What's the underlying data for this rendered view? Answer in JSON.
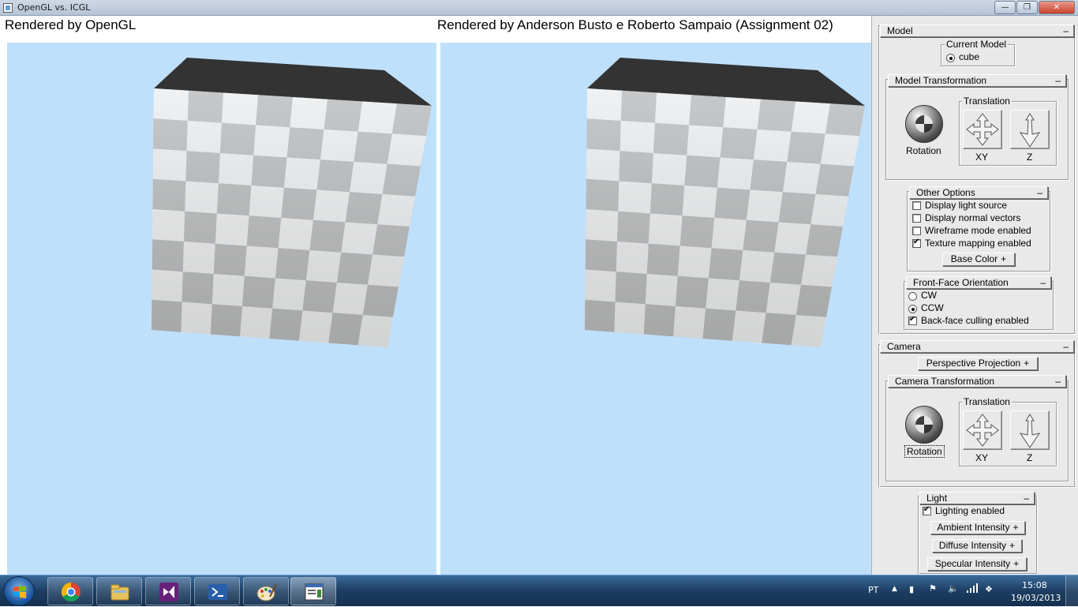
{
  "window": {
    "title": "OpenGL vs. ICGL"
  },
  "viewports": {
    "left_title": "Rendered by OpenGL",
    "right_title": "Rendered by Anderson Busto e Roberto Sampaio (Assignment 02)"
  },
  "panel": {
    "model": {
      "header": "Model",
      "current_model_label": "Current Model",
      "current_model_value": "cube",
      "transform": {
        "header": "Model Transformation",
        "rotation_label": "Rotation",
        "translation_label": "Translation",
        "xy_label": "XY",
        "z_label": "Z"
      },
      "other_options": {
        "header": "Other Options",
        "items": [
          {
            "label": "Display light source",
            "checked": false
          },
          {
            "label": "Display normal vectors",
            "checked": false
          },
          {
            "label": "Wireframe mode enabled",
            "checked": false
          },
          {
            "label": "Texture mapping enabled",
            "checked": true
          }
        ],
        "base_color": "Base Color"
      },
      "front_face": {
        "header": "Front-Face Orientation",
        "cw": "CW",
        "ccw": "CCW",
        "selected": "CCW",
        "culling_label": "Back-face culling enabled",
        "culling_checked": true
      }
    },
    "camera": {
      "header": "Camera",
      "projection_button": "Perspective Projection",
      "transform": {
        "header": "Camera Transformation",
        "rotation_label": "Rotation",
        "translation_label": "Translation",
        "xy_label": "XY",
        "z_label": "Z"
      }
    },
    "light": {
      "header": "Light",
      "lighting_label": "Lighting enabled",
      "lighting_checked": true,
      "ambient": "Ambient Intensity",
      "diffuse": "Diffuse Intensity",
      "specular": "Specular Intensity"
    },
    "collapse_symbol": "–",
    "expand_symbol": "+"
  },
  "taskbar": {
    "apps": [
      "chrome-icon",
      "explorer-icon",
      "visual-studio-icon",
      "powershell-icon",
      "paint-icon",
      "app-window-icon"
    ],
    "language": "PT",
    "time": "15:08",
    "date": "19/03/2013"
  },
  "colors": {
    "viewport_bg": "#bfe0fb",
    "cube_top": "#333333",
    "checker_light": "#f0f0f0",
    "checker_dark": "#bcbcbc"
  }
}
